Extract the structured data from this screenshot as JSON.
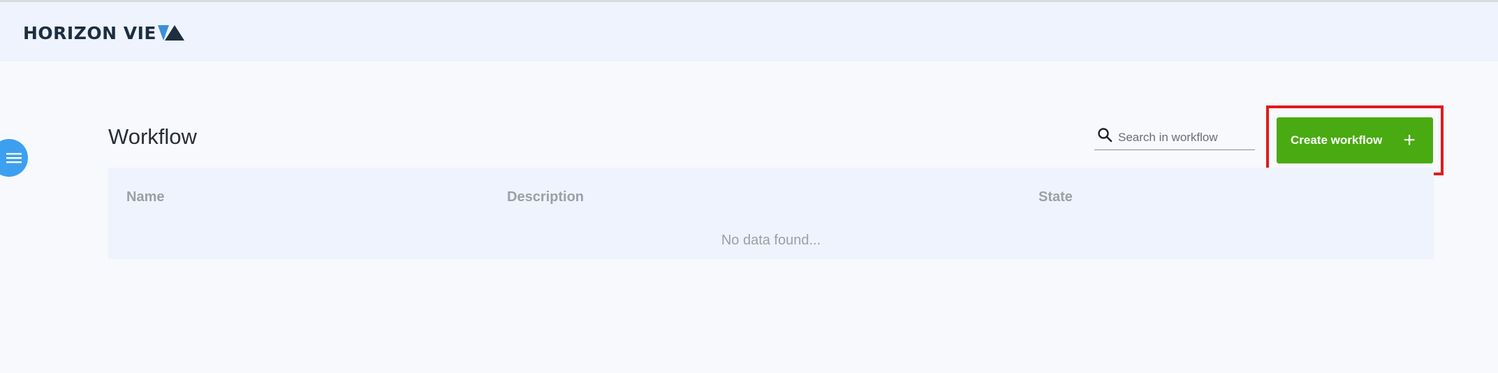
{
  "app": {
    "logo_text": "HORIZON VIE",
    "logo_mark_icon": "triangle-logo-icon",
    "brand_color": "#1c2e40",
    "accent_color": "#3d9ff0"
  },
  "sidebar": {
    "toggle_icon": "menu-icon"
  },
  "main": {
    "title": "Workflow",
    "search": {
      "placeholder": "Search in workflow",
      "value": "",
      "icon": "search-icon"
    },
    "create_button": {
      "label": "Create workflow",
      "plus": "+",
      "color": "#4aaa12"
    },
    "highlight_color": "#e01b1b",
    "table": {
      "columns": [
        "Name",
        "Description",
        "State"
      ],
      "rows": [],
      "empty_text": "No data found..."
    }
  }
}
